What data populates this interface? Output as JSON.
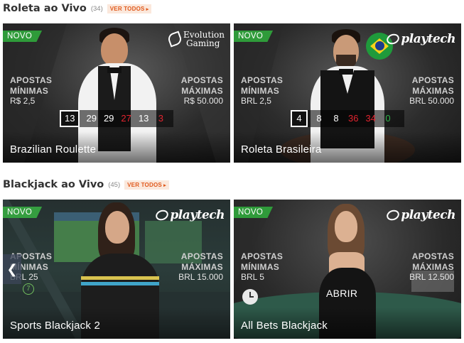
{
  "sections": [
    {
      "title": "Roleta ao Vivo",
      "count": "(34)",
      "see_all": "VER TODOS"
    },
    {
      "title": "Blackjack ao Vivo",
      "count": "(45)",
      "see_all": "VER TODOS"
    }
  ],
  "min_label_1": "APOSTAS",
  "min_label_2": "MÍNIMAS",
  "max_label_1": "APOSTAS",
  "max_label_2": "MÁXIMAS",
  "new_badge": "NOVO",
  "cards": [
    {
      "name": "Brazilian Roulette",
      "provider": "Evolution Gaming",
      "provider_line1": "Evolution",
      "provider_line2": "Gaming",
      "min": "R$ 2,5",
      "max": "R$ 50.000",
      "results": [
        "13",
        "29",
        "29",
        "27",
        "13",
        "3"
      ],
      "result_colors": [
        "black",
        "black",
        "black",
        "red",
        "black",
        "red"
      ]
    },
    {
      "name": "Roleta Brasileira",
      "provider": "playtech",
      "min": "BRL 2,5",
      "max": "BRL 50.000",
      "results": [
        "4",
        "8",
        "8",
        "36",
        "34",
        "0"
      ],
      "result_colors": [
        "black",
        "black",
        "black",
        "red",
        "red",
        "green"
      ]
    },
    {
      "name": "Sports Blackjack 2",
      "provider": "playtech",
      "min": "BRL 25",
      "max": "BRL 15.000",
      "seats_badge": "7"
    },
    {
      "name": "All Bets Blackjack",
      "provider": "playtech",
      "min": "BRL 5",
      "max": "BRL 12.500",
      "open_label": "ABRIR"
    }
  ],
  "colors": {
    "accent_orange": "#e0591c",
    "new_green": "#2f9b3a",
    "red_number": "#e2242f",
    "green_number": "#2fb34a"
  },
  "icons": [
    "chevron-left-icon",
    "clock-icon",
    "evolution-logo",
    "playtech-logo",
    "brazil-flag-icon"
  ]
}
